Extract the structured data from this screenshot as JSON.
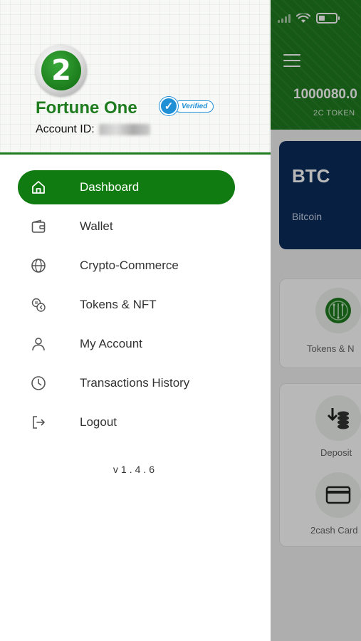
{
  "background_app": {
    "balance": "1000080.0",
    "balance_label": "2C TOKEN",
    "card": {
      "symbol": "BTC",
      "name": "Bitcoin"
    },
    "tiles": [
      {
        "label": "Tokens & N",
        "icon": "chip-coin-icon"
      },
      {
        "label": "Deposit",
        "icon": "deposit-coins-icon"
      },
      {
        "label": "2cash Card",
        "icon": "credit-card-icon"
      }
    ]
  },
  "drawer": {
    "logo_text": "2",
    "brand_name": "Fortune One",
    "verified_label": "Verified",
    "account_label": "Account ID:",
    "menu": [
      {
        "label": "Dashboard",
        "icon": "home-icon",
        "active": true
      },
      {
        "label": "Wallet",
        "icon": "wallet-icon",
        "active": false
      },
      {
        "label": "Crypto-Commerce",
        "icon": "globe-icon",
        "active": false
      },
      {
        "label": "Tokens & NFT",
        "icon": "tokens-icon",
        "active": false
      },
      {
        "label": "My Account",
        "icon": "user-icon",
        "active": false
      },
      {
        "label": "Transactions History",
        "icon": "clock-icon",
        "active": false
      },
      {
        "label": "Logout",
        "icon": "logout-icon",
        "active": false
      }
    ],
    "version": "v1.4.6"
  },
  "colors": {
    "brand_green": "#107b10",
    "header_green": "#1f7a1f",
    "card_navy": "#0b2c5b",
    "verified_blue": "#1f8fd6"
  }
}
